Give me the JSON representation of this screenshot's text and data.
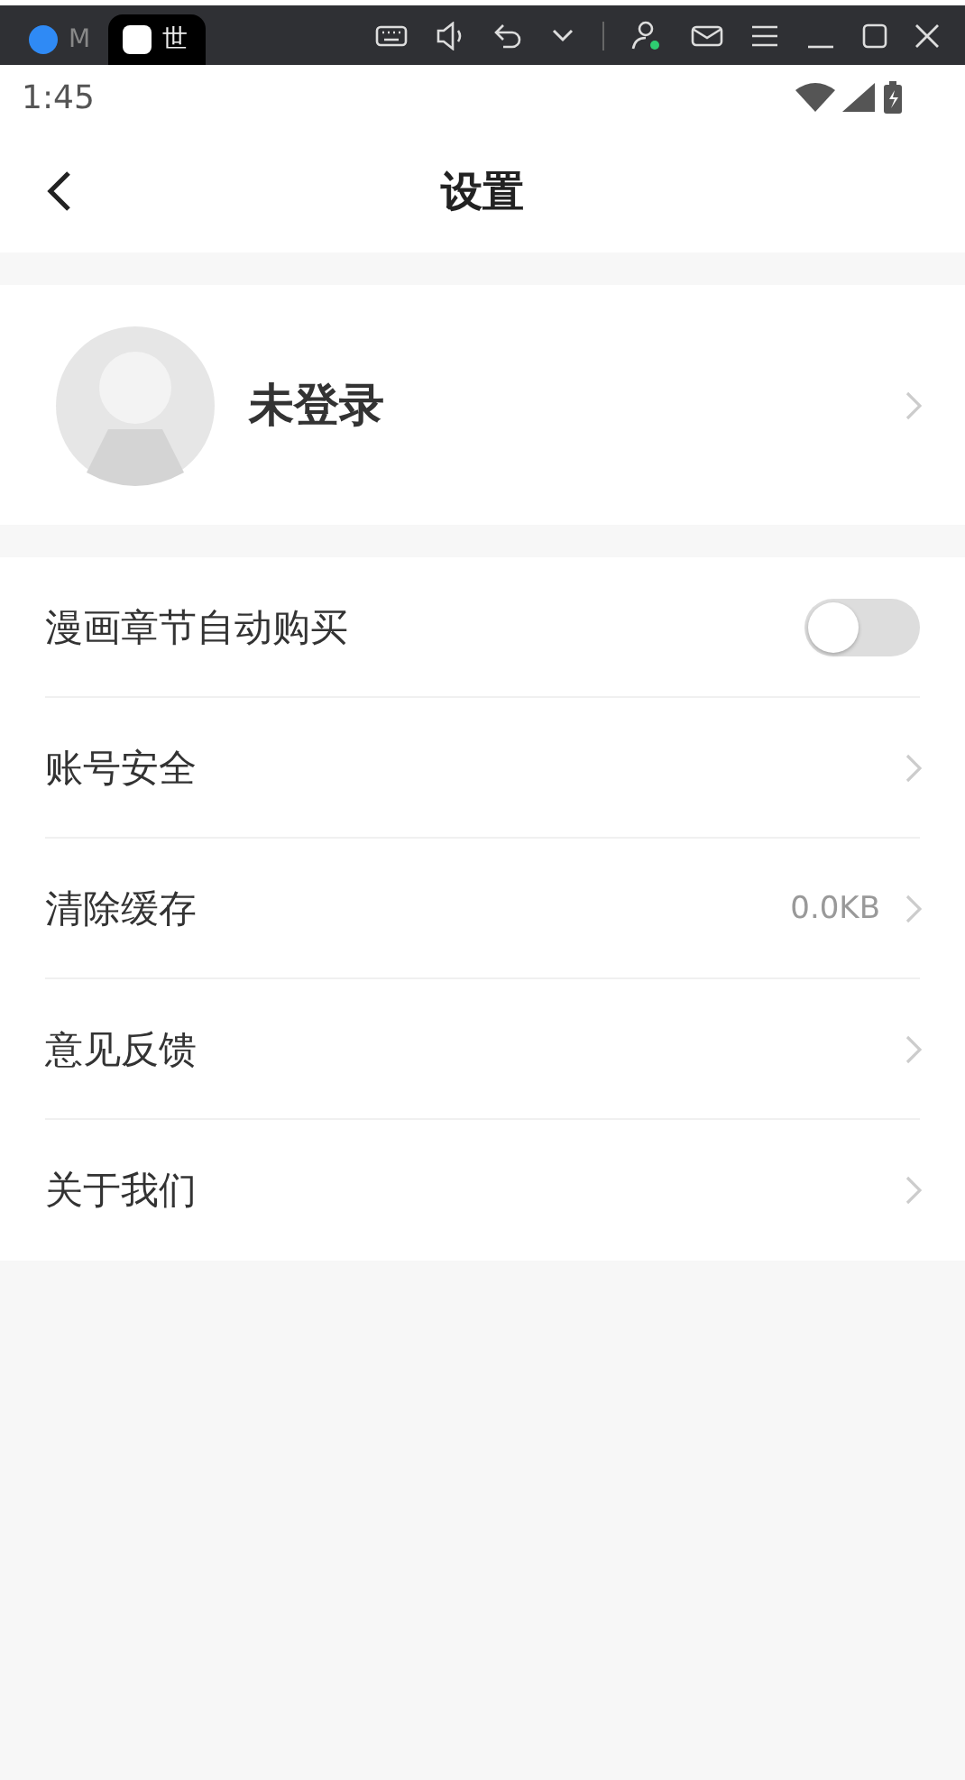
{
  "window_tabs": [
    {
      "label": "M",
      "selected": false
    },
    {
      "label": "世",
      "selected": true
    }
  ],
  "status_bar": {
    "time": "1:45"
  },
  "header": {
    "title": "设置"
  },
  "profile": {
    "name": "未登录"
  },
  "settings": [
    {
      "kind": "toggle",
      "label": "漫画章节自动购买",
      "on": false
    },
    {
      "kind": "link",
      "label": "账号安全"
    },
    {
      "kind": "link",
      "label": "清除缓存",
      "value": "0.0KB"
    },
    {
      "kind": "link",
      "label": "意见反馈"
    },
    {
      "kind": "link",
      "label": "关于我们"
    }
  ]
}
